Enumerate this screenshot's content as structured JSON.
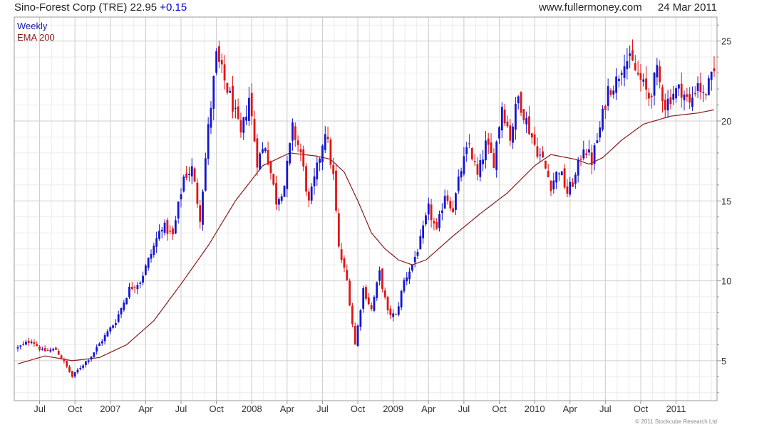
{
  "header": {
    "security": "Sino-Forest Corp (TRE)",
    "price": "22.95",
    "change": "+0.15",
    "site": "www.fullermoney.com",
    "date": "24 Mar 2011"
  },
  "footer": {
    "copyright": "© 2011 Stockcube Research Ltd"
  },
  "colors": {
    "up": "#1515d0",
    "down": "#e01515",
    "ema": "#8b1a1a",
    "grid_major": "#cfcfcf",
    "grid_minor": "#ebebeb"
  },
  "chart_data": {
    "type": "candlestick",
    "frequency": "Weekly",
    "legend": [
      "Weekly",
      "EMA 200"
    ],
    "y_axis": {
      "side": "right",
      "ylim": [
        2.5,
        26.5
      ],
      "ticks": [
        5,
        10,
        15,
        20,
        25
      ],
      "minor_step": 1
    },
    "x_axis": {
      "tick_labels": [
        "Jul",
        "Oct",
        "2007",
        "Apr",
        "Jul",
        "Oct",
        "2008",
        "Apr",
        "Jul",
        "Oct",
        "2009",
        "Apr",
        "Jul",
        "Oct",
        "2010",
        "Apr",
        "Jul",
        "Oct",
        "2011"
      ],
      "first_label_week": 8,
      "label_every_weeks": 13,
      "total_weeks": 257
    },
    "grid": true,
    "close_anchors": [
      [
        0,
        5.8
      ],
      [
        5,
        6.3
      ],
      [
        9,
        5.6
      ],
      [
        14,
        5.7
      ],
      [
        17,
        4.9
      ],
      [
        20,
        4.0
      ],
      [
        23,
        4.6
      ],
      [
        27,
        5.3
      ],
      [
        31,
        6.3
      ],
      [
        36,
        7.5
      ],
      [
        41,
        9.5
      ],
      [
        45,
        10.0
      ],
      [
        49,
        11.7
      ],
      [
        53,
        13.5
      ],
      [
        57,
        12.8
      ],
      [
        61,
        16.5
      ],
      [
        64,
        17.0
      ],
      [
        67,
        14.0
      ],
      [
        70,
        19.5
      ],
      [
        73,
        24.0
      ],
      [
        76,
        22.5
      ],
      [
        79,
        21.0
      ],
      [
        82,
        19.0
      ],
      [
        85,
        21.5
      ],
      [
        88,
        17.5
      ],
      [
        91,
        18.5
      ],
      [
        95,
        15.0
      ],
      [
        98,
        16.0
      ],
      [
        101,
        19.5
      ],
      [
        104,
        18.0
      ],
      [
        107,
        14.8
      ],
      [
        110,
        17.0
      ],
      [
        113,
        19.5
      ],
      [
        116,
        16.5
      ],
      [
        118,
        12.0
      ],
      [
        121,
        10.0
      ],
      [
        124,
        6.0
      ],
      [
        127,
        9.5
      ],
      [
        130,
        8.2
      ],
      [
        133,
        10.5
      ],
      [
        136,
        8.0
      ],
      [
        139,
        7.8
      ],
      [
        142,
        10.0
      ],
      [
        145,
        11.0
      ],
      [
        148,
        12.5
      ],
      [
        151,
        14.5
      ],
      [
        154,
        13.0
      ],
      [
        157,
        15.5
      ],
      [
        160,
        14.5
      ],
      [
        163,
        17.0
      ],
      [
        166,
        18.5
      ],
      [
        169,
        16.5
      ],
      [
        172,
        18.5
      ],
      [
        175,
        17.5
      ],
      [
        178,
        21.0
      ],
      [
        181,
        19.0
      ],
      [
        184,
        21.5
      ],
      [
        187,
        20.0
      ],
      [
        190,
        18.5
      ],
      [
        193,
        17.5
      ],
      [
        196,
        16.0
      ],
      [
        199,
        17.0
      ],
      [
        202,
        15.5
      ],
      [
        205,
        16.5
      ],
      [
        208,
        18.5
      ],
      [
        211,
        17.5
      ],
      [
        214,
        19.5
      ],
      [
        217,
        22.0
      ],
      [
        220,
        22.5
      ],
      [
        223,
        24.0
      ],
      [
        226,
        23.5
      ],
      [
        229,
        22.5
      ],
      [
        232,
        21.5
      ],
      [
        235,
        23.0
      ],
      [
        238,
        21.0
      ],
      [
        241,
        21.8
      ],
      [
        244,
        22.0
      ],
      [
        247,
        21.0
      ],
      [
        250,
        22.5
      ],
      [
        252,
        21.5
      ],
      [
        256,
        22.95
      ]
    ],
    "ema_200": [
      [
        0,
        4.8
      ],
      [
        10,
        5.3
      ],
      [
        20,
        5.0
      ],
      [
        30,
        5.2
      ],
      [
        40,
        6.0
      ],
      [
        50,
        7.5
      ],
      [
        60,
        9.8
      ],
      [
        70,
        12.2
      ],
      [
        80,
        15.0
      ],
      [
        90,
        17.2
      ],
      [
        100,
        18.0
      ],
      [
        110,
        17.8
      ],
      [
        115,
        17.6
      ],
      [
        120,
        16.8
      ],
      [
        125,
        15.0
      ],
      [
        130,
        13.0
      ],
      [
        135,
        12.0
      ],
      [
        140,
        11.3
      ],
      [
        145,
        11.0
      ],
      [
        150,
        11.3
      ],
      [
        160,
        12.8
      ],
      [
        170,
        14.2
      ],
      [
        180,
        15.5
      ],
      [
        190,
        17.2
      ],
      [
        196,
        17.9
      ],
      [
        205,
        17.6
      ],
      [
        210,
        17.3
      ],
      [
        215,
        17.7
      ],
      [
        222,
        18.8
      ],
      [
        230,
        19.8
      ],
      [
        240,
        20.3
      ],
      [
        250,
        20.5
      ],
      [
        256,
        20.7
      ]
    ]
  }
}
